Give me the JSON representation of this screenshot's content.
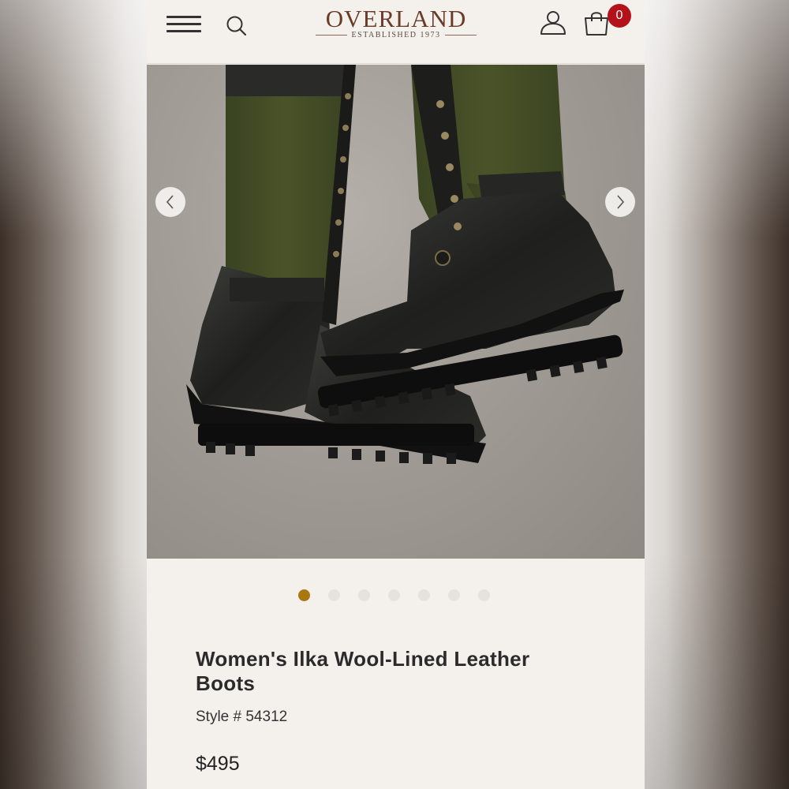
{
  "header": {
    "brand_name": "OVERLAND",
    "brand_tagline": "ESTABLISHED 1973",
    "cart_count": "0",
    "icons": [
      "menu-icon",
      "search-icon",
      "account-icon",
      "shopping-bag-icon"
    ],
    "badge_color": "#b3121a",
    "brand_color": "#6a3b28"
  },
  "gallery": {
    "image_alt": "Women's Ilka Wool-Lined Leather Boots",
    "slide_count": 7,
    "active_slide": 1,
    "active_dot_color": "#a8780f",
    "prev_icon": "chevron-left-icon",
    "next_icon": "chevron-right-icon"
  },
  "product": {
    "title": "Women's Ilka Wool-Lined Leather Boots",
    "style": "Style # 54312",
    "price": "$495"
  }
}
